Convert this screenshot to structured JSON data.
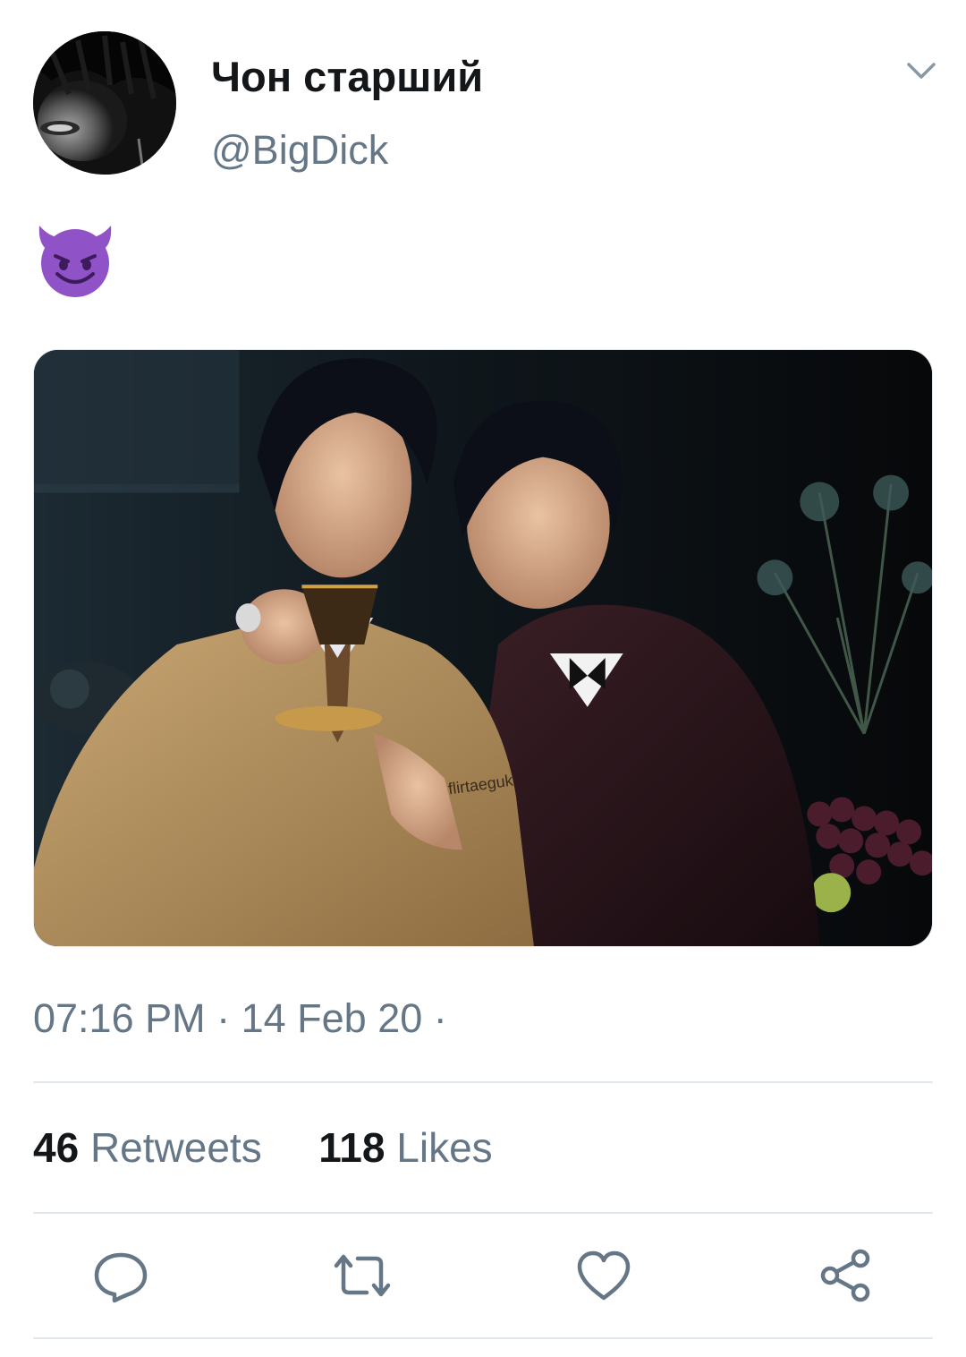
{
  "tweet": {
    "display_name": "Чон старший",
    "handle": "@BigDick",
    "text_emoji": "😈",
    "media_watermark": "flirtaeguk",
    "timestamp": "07:16 PM · 14 Feb 20 ·",
    "retweets_count": "46",
    "retweets_label": "Retweets",
    "likes_count": "118",
    "likes_label": "Likes"
  },
  "icons": {
    "menu": "chevron-down-icon",
    "reply": "reply-icon",
    "retweet": "retweet-icon",
    "like": "heart-icon",
    "share": "share-icon"
  },
  "colors": {
    "text_primary": "#14171a",
    "text_secondary": "#657786",
    "divider": "#e1e8ed",
    "emoji_purple": "#8f52c7"
  }
}
